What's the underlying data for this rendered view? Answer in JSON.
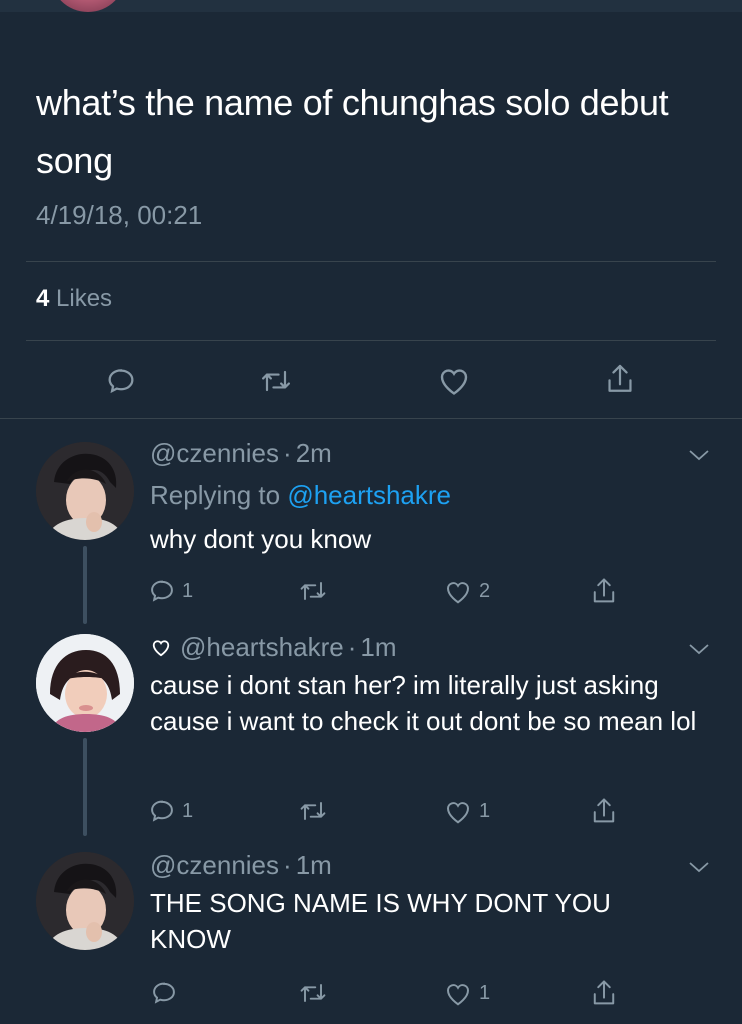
{
  "main_tweet": {
    "text": "what’s the name of chunghas solo debut song",
    "timestamp": "4/19/18, 00:21",
    "likes_count": "4",
    "likes_label": "Likes"
  },
  "replies": [
    {
      "handle": "@czennies",
      "time": "2m",
      "replying_prefix": "Replying to",
      "replying_to": "@heartshakre",
      "text": "why dont you know",
      "reply_count": "1",
      "like_count": "2",
      "liked_badge": false
    },
    {
      "handle": "@heartshakre",
      "time": "1m",
      "text": "cause i dont stan her? im literally just asking cause i want to check it out dont be so mean lol",
      "reply_count": "1",
      "like_count": "1",
      "liked_badge": true
    },
    {
      "handle": "@czennies",
      "time": "1m",
      "text": "THE SONG NAME IS WHY DONT YOU KNOW",
      "reply_count": "",
      "like_count": "1",
      "liked_badge": false
    }
  ],
  "separator": "·",
  "icons": {
    "reply": "reply-icon",
    "retweet": "retweet-icon",
    "like": "heart-icon",
    "share": "share-icon",
    "more": "chevron-down-icon"
  },
  "colors": {
    "background": "#1b2836",
    "muted": "#8899a6",
    "link": "#1da1f2",
    "divider": "#38444d"
  }
}
